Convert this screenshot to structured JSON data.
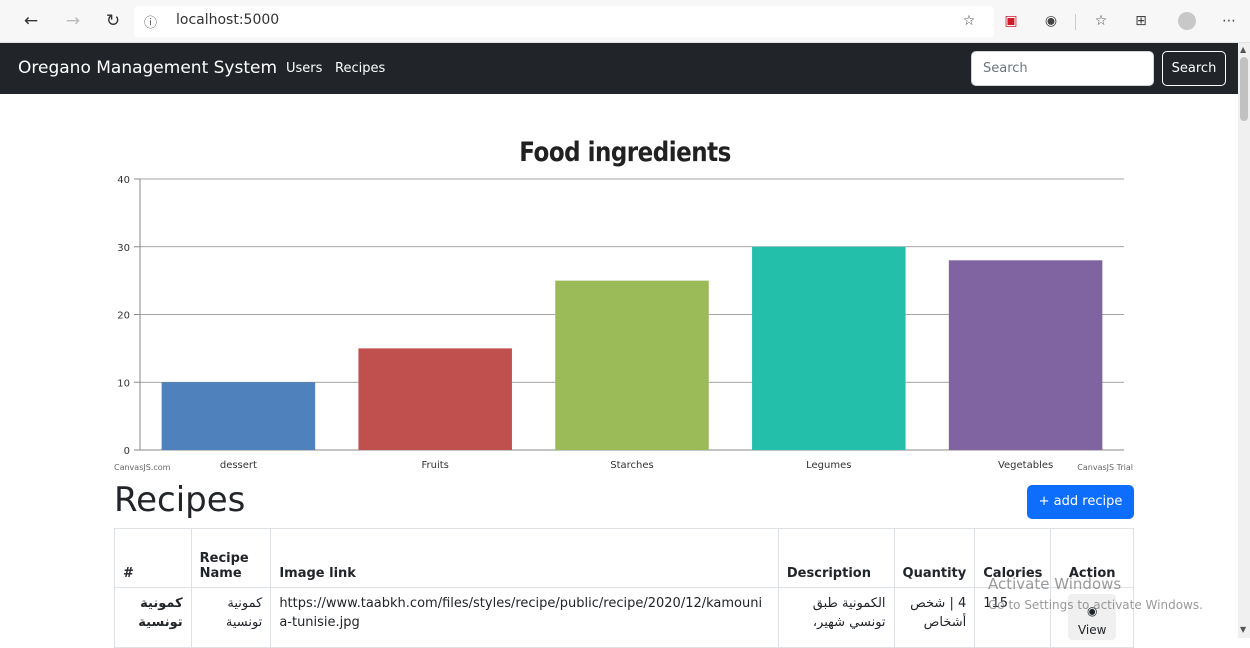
{
  "browser": {
    "url": "localhost:5000",
    "back_icon": "arrow-left-icon",
    "forward_icon": "arrow-right-icon",
    "reload_icon": "reload-icon"
  },
  "navbar": {
    "brand": "Oregano Management System",
    "links": [
      "Users",
      "Recipes"
    ],
    "search_placeholder": "Search",
    "search_button": "Search",
    "bg_color": "#212529"
  },
  "chart_data": {
    "type": "bar",
    "title": "Food ingredients",
    "categories": [
      "dessert",
      "Fruits",
      "Starches",
      "Legumes",
      "Vegetables"
    ],
    "values": [
      10,
      15,
      25,
      30,
      28
    ],
    "colors": [
      "#4F81BC",
      "#C0504E",
      "#9BBB58",
      "#23BFAA",
      "#8064A1"
    ],
    "ylim": [
      0,
      40
    ],
    "yticks": [
      0,
      10,
      20,
      30,
      40
    ],
    "grid": true,
    "credit_left": "CanvasJS.com",
    "credit_right": "CanvasJS Trial"
  },
  "recipes": {
    "title": "Recipes",
    "add_button": "+ add recipe",
    "headers": [
      "#",
      "Recipe Name",
      "Image link",
      "Description",
      "Quantity",
      "Calories",
      "Action"
    ],
    "rows": [
      {
        "id": "كمونية تونسية",
        "name": "كمونية تونسية",
        "image_link": "https://www.taabkh.com/files/styles/recipe/public/recipe/2020/12/kamounia-tunisie.jpg",
        "description": "الكمونية طبق تونسي شهير،",
        "quantity": "4 | شخص أشخاص",
        "calories": "115",
        "action": "View"
      }
    ]
  },
  "watermark": {
    "line1": "Activate Windows",
    "line2": "Go to Settings to activate Windows."
  }
}
